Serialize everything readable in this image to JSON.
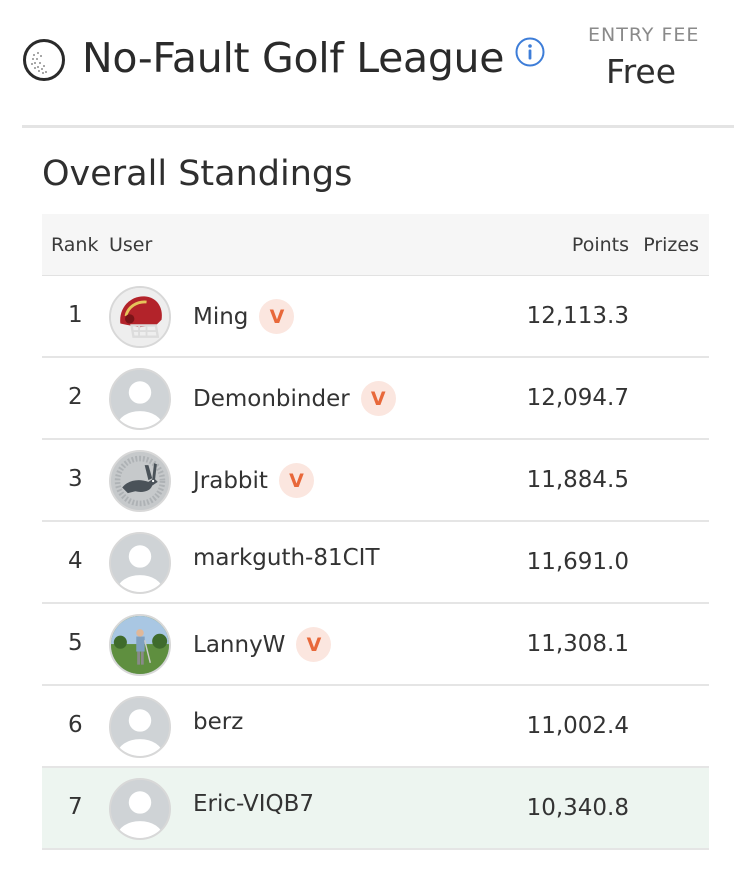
{
  "league": {
    "title": "No-Fault Golf League",
    "icon": "golf-ball-icon",
    "info_icon": "info-icon",
    "entry_fee_label": "ENTRY FEE",
    "entry_fee_value": "Free"
  },
  "standings": {
    "title": "Overall Standings",
    "columns": {
      "rank": "Rank",
      "user": "User",
      "points": "Points",
      "prizes": "Prizes"
    },
    "badge_label": "V",
    "colors": {
      "badge_bg": "#fbe6df",
      "badge_text": "#e8683a",
      "highlight_row": "#edf5f0"
    },
    "rows": [
      {
        "rank": "1",
        "user": "Ming",
        "points": "12,113.3",
        "verified": true,
        "avatar": "football-helmet-avatar"
      },
      {
        "rank": "2",
        "user": "Demonbinder",
        "points": "12,094.7",
        "verified": true,
        "avatar": "default-avatar"
      },
      {
        "rank": "3",
        "user": "Jrabbit",
        "points": "11,884.5",
        "verified": true,
        "avatar": "jackrabbit-avatar"
      },
      {
        "rank": "4",
        "user": "markguth-81CIT",
        "points": "11,691.0",
        "verified": false,
        "avatar": "default-avatar"
      },
      {
        "rank": "5",
        "user": "LannyW",
        "points": "11,308.1",
        "verified": true,
        "avatar": "golfer-photo-avatar"
      },
      {
        "rank": "6",
        "user": "berz",
        "points": "11,002.4",
        "verified": false,
        "avatar": "default-avatar"
      },
      {
        "rank": "7",
        "user": "Eric-VIQB7",
        "points": "10,340.8",
        "verified": false,
        "avatar": "default-avatar",
        "highlighted": true
      }
    ]
  }
}
